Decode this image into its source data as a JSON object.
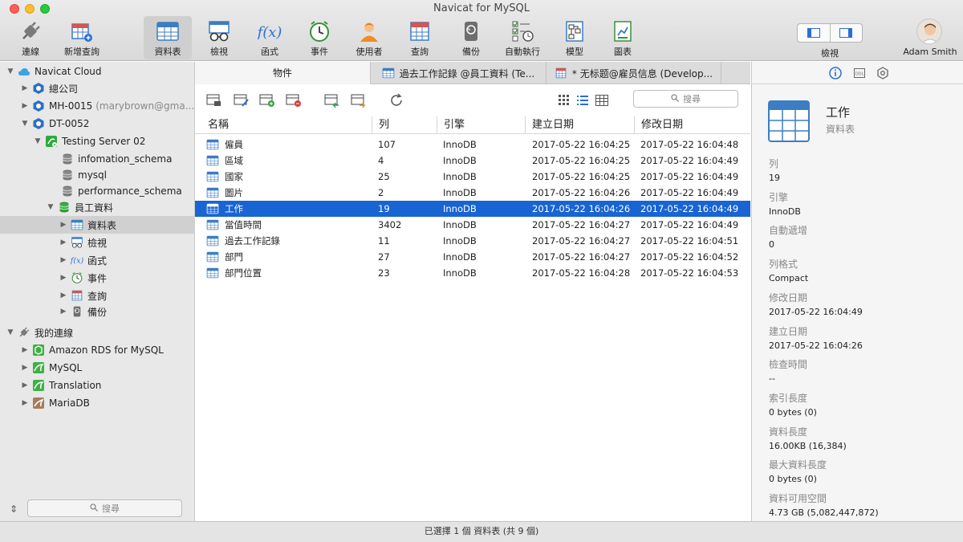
{
  "window": {
    "title": "Navicat for MySQL"
  },
  "toolbar": {
    "items": [
      {
        "label": "連線",
        "icon": "plug-icon"
      },
      {
        "label": "新增查詢",
        "icon": "new-query-icon"
      },
      {
        "label": "資料表",
        "icon": "table-icon",
        "active": true
      },
      {
        "label": "檢視",
        "icon": "view-icon"
      },
      {
        "label": "函式",
        "icon": "function-icon"
      },
      {
        "label": "事件",
        "icon": "clock-icon"
      },
      {
        "label": "使用者",
        "icon": "user-icon"
      },
      {
        "label": "查詢",
        "icon": "query-icon"
      },
      {
        "label": "備份",
        "icon": "backup-icon"
      },
      {
        "label": "自動執行",
        "icon": "automation-icon"
      },
      {
        "label": "模型",
        "icon": "model-icon"
      },
      {
        "label": "圖表",
        "icon": "chart-icon"
      }
    ],
    "view_label": "檢視",
    "user_name": "Adam Smith"
  },
  "sidebar": {
    "rows": [
      {
        "label": "Navicat Cloud",
        "icon": "cloud-icon",
        "arrow": "▼"
      },
      {
        "label": "總公司",
        "icon": "project-icon",
        "arrow": "▶"
      },
      {
        "label": "MH-0015",
        "sub": "(marybrown@gma...",
        "icon": "project-icon",
        "arrow": "▶"
      },
      {
        "label": "DT-0052",
        "icon": "project-icon",
        "arrow": "▼"
      },
      {
        "label": "Testing Server 02",
        "icon": "server-icon",
        "arrow": "▼"
      },
      {
        "label": "infomation_schema",
        "icon": "database-icon",
        "arrow": ""
      },
      {
        "label": "mysql",
        "icon": "database-icon",
        "arrow": ""
      },
      {
        "label": "performance_schema",
        "icon": "database-icon",
        "arrow": ""
      },
      {
        "label": "員工資料",
        "icon": "database-active-icon",
        "arrow": "▼"
      },
      {
        "label": "資料表",
        "icon": "table-icon",
        "arrow": "▶",
        "selected": true
      },
      {
        "label": "檢視",
        "icon": "view-icon",
        "arrow": "▶"
      },
      {
        "label": "函式",
        "icon": "function-icon",
        "arrow": "▶"
      },
      {
        "label": "事件",
        "icon": "clock-icon",
        "arrow": "▶"
      },
      {
        "label": "查詢",
        "icon": "query-icon",
        "arrow": "▶"
      },
      {
        "label": "備份",
        "icon": "backup-icon",
        "arrow": "▶"
      },
      {
        "label": "我的連線",
        "icon": "plug-icon",
        "arrow": "▼"
      },
      {
        "label": "Amazon RDS for MySQL",
        "icon": "amazon-rds-icon",
        "arrow": "▶"
      },
      {
        "label": "MySQL",
        "icon": "mysql-icon",
        "arrow": "▶"
      },
      {
        "label": "Translation",
        "icon": "mysql-icon",
        "arrow": "▶"
      },
      {
        "label": "MariaDB",
        "icon": "mariadb-icon",
        "arrow": "▶"
      }
    ],
    "search_placeholder": "搜尋"
  },
  "tabs": [
    {
      "label": "物件",
      "active": true
    },
    {
      "label": "過去工作記錄 @員工資料 (Te..."
    },
    {
      "label": "* 无标题@雇员信息 (Develop..."
    }
  ],
  "object_search_placeholder": "搜尋",
  "table": {
    "columns": [
      "名稱",
      "列",
      "引擎",
      "建立日期",
      "修改日期"
    ],
    "rows": [
      [
        "僱員",
        "107",
        "InnoDB",
        "2017-05-22 16:04:25",
        "2017-05-22 16:04:48"
      ],
      [
        "區域",
        "4",
        "InnoDB",
        "2017-05-22 16:04:25",
        "2017-05-22 16:04:49"
      ],
      [
        "國家",
        "25",
        "InnoDB",
        "2017-05-22 16:04:25",
        "2017-05-22 16:04:49"
      ],
      [
        "圖片",
        "2",
        "InnoDB",
        "2017-05-22 16:04:26",
        "2017-05-22 16:04:49"
      ],
      [
        "工作",
        "19",
        "InnoDB",
        "2017-05-22 16:04:26",
        "2017-05-22 16:04:49"
      ],
      [
        "當值時間",
        "3402",
        "InnoDB",
        "2017-05-22 16:04:27",
        "2017-05-22 16:04:49"
      ],
      [
        "過去工作記錄",
        "11",
        "InnoDB",
        "2017-05-22 16:04:27",
        "2017-05-22 16:04:51"
      ],
      [
        "部門",
        "27",
        "InnoDB",
        "2017-05-22 16:04:27",
        "2017-05-22 16:04:52"
      ],
      [
        "部門位置",
        "23",
        "InnoDB",
        "2017-05-22 16:04:28",
        "2017-05-22 16:04:53"
      ]
    ],
    "selected_index": 4
  },
  "info": {
    "title": "工作",
    "subtitle": "資料表",
    "props": [
      {
        "k": "列",
        "v": "19"
      },
      {
        "k": "引擎",
        "v": "InnoDB"
      },
      {
        "k": "自動遞增",
        "v": "0"
      },
      {
        "k": "列格式",
        "v": "Compact"
      },
      {
        "k": "修改日期",
        "v": "2017-05-22 16:04:49"
      },
      {
        "k": "建立日期",
        "v": "2017-05-22 16:04:26"
      },
      {
        "k": "檢查時間",
        "v": "--"
      },
      {
        "k": "索引長度",
        "v": "0 bytes (0)"
      },
      {
        "k": "資料長度",
        "v": "16.00KB (16,384)"
      },
      {
        "k": "最大資料長度",
        "v": "0 bytes (0)"
      },
      {
        "k": "資料可用空間",
        "v": "4.73 GB (5,082,447,872)"
      }
    ]
  },
  "status": {
    "text": "已選擇 1 個 資料表 (共 9 個)"
  },
  "colors": {
    "selection": "#1864d2",
    "table_blue": "#3c7dc4",
    "server_green": "#2eaa3c"
  }
}
